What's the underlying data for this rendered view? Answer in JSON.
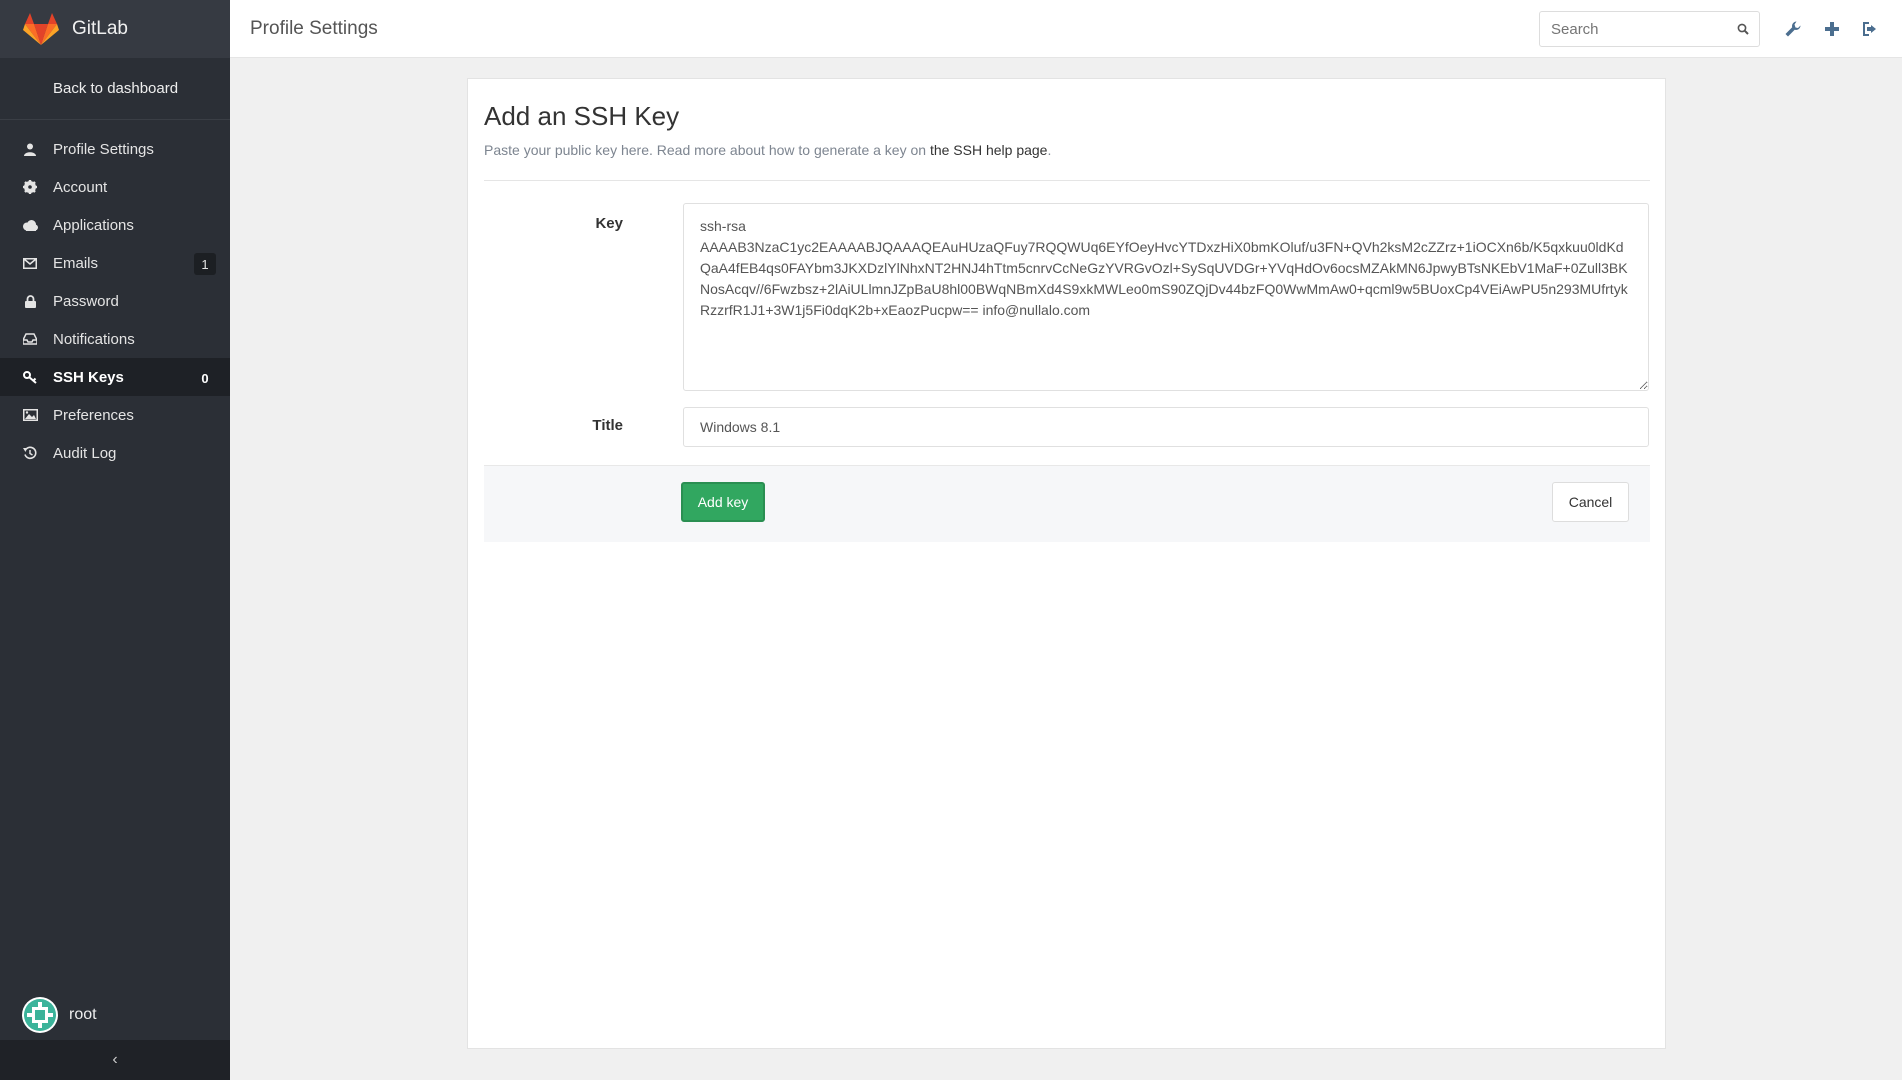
{
  "brand": {
    "name": "GitLab",
    "icon": "gitlab-fox-logo",
    "color": "#fc6d26"
  },
  "sidebar": {
    "back_label": "Back to dashboard",
    "items": [
      {
        "label": "Profile Settings",
        "icon": "user-icon"
      },
      {
        "label": "Account",
        "icon": "gear-icon"
      },
      {
        "label": "Applications",
        "icon": "cloud-icon"
      },
      {
        "label": "Emails",
        "icon": "envelope-icon",
        "count": "1"
      },
      {
        "label": "Password",
        "icon": "lock-icon"
      },
      {
        "label": "Notifications",
        "icon": "inbox-icon"
      },
      {
        "label": "SSH Keys",
        "icon": "key-icon",
        "count": "0",
        "active": true
      },
      {
        "label": "Preferences",
        "icon": "image-icon"
      },
      {
        "label": "Audit Log",
        "icon": "history-icon"
      }
    ],
    "user": {
      "name": "root"
    },
    "collapse_label": "‹"
  },
  "header": {
    "title": "Profile Settings",
    "search_placeholder": "Search"
  },
  "form": {
    "heading": "Add an SSH Key",
    "description_prefix": "Paste your public key here. Read more about how to generate a key on ",
    "help_link": "the SSH help page",
    "description_suffix": ".",
    "key_label": "Key",
    "key_value": "ssh-rsa\nAAAAB3NzaC1yc2EAAAABJQAAAQEAuHUzaQFuy7RQQWUq6EYfOeyHvcYTDxzHiX0bmKOluf/u3FN+QVh2ksM2cZZrz+1iOCXn6b/K5qxkuu0ldKdQaA4fEB4qs0FAYbm3JKXDzlYlNhxNT2HNJ4hTtm5cnrvCcNeGzYVRGvOzl+SySqUVDGr+YVqHdOv6ocsMZAkMN6JpwyBTsNKEbV1MaF+0Zull3BKNosAcqv//6Fwzbsz+2lAiULlmnJZpBaU8hl00BWqNBmXd4S9xkMWLeo0mS90ZQjDv44bzFQ0WwMmAw0+qcml9w5BUoxCp4VEiAwPU5n293MUfrtykRzzrfR1J1+3W1j5Fi0dqK2b+xEaozPucpw== info@nullalo.com",
    "title_label": "Title",
    "title_value": "Windows 8.1",
    "submit_label": "Add key",
    "cancel_label": "Cancel"
  },
  "colors": {
    "sidebar_bg": "#2b2f36",
    "primary_button": "#31a760"
  }
}
